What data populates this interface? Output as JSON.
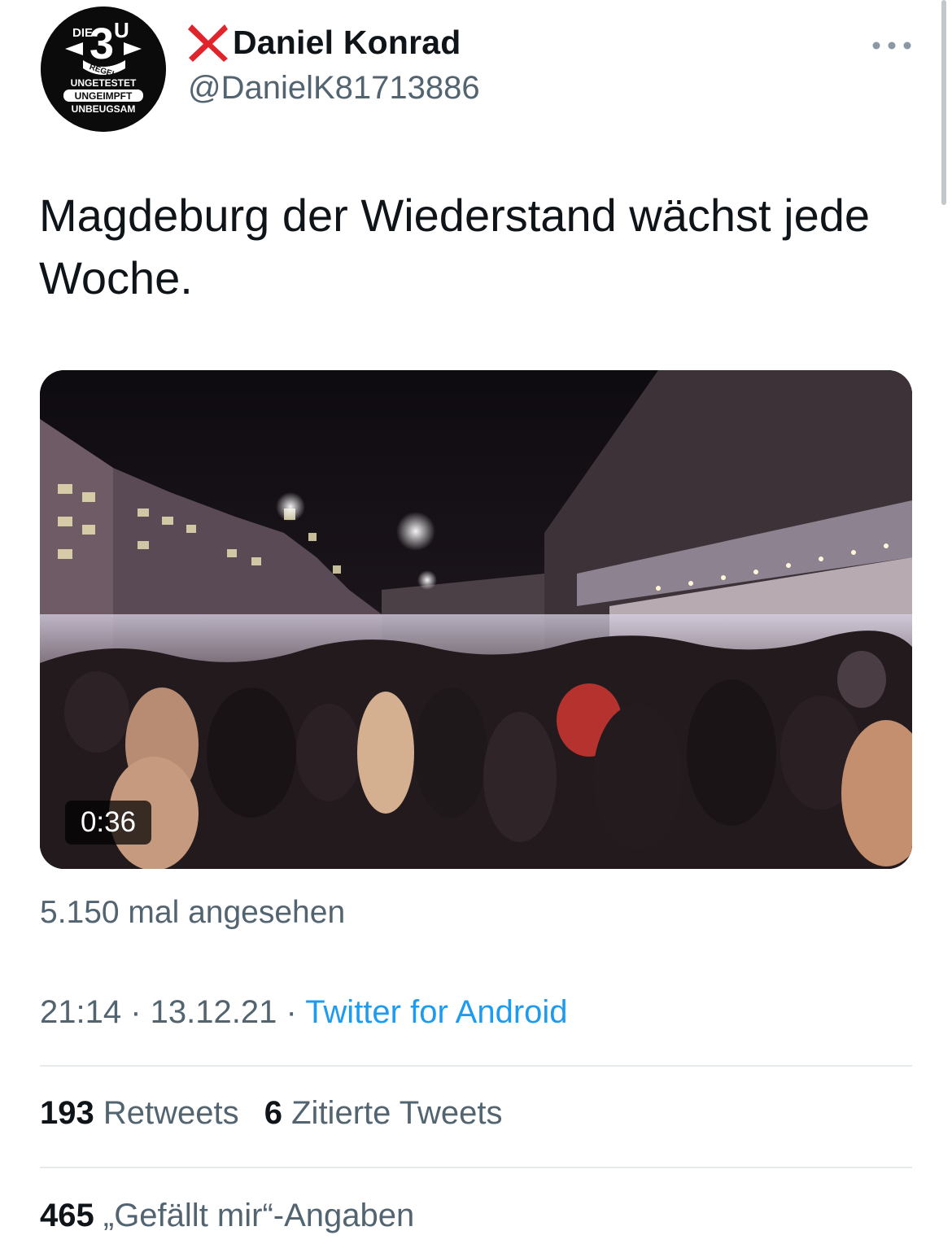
{
  "avatar": {
    "top_text": "DIE",
    "number": "3",
    "letter": "U",
    "ribbon": "REGEL",
    "lines": [
      "UNGETESTET",
      "UNGEIMPFT",
      "UNBEUGSAM"
    ]
  },
  "author": {
    "name_prefix_icon": "red-x-icon",
    "display_name": "Daniel Konrad",
    "handle": "@DanielK81713886"
  },
  "more_icon": "more-horizontal-icon",
  "tweet": {
    "text": "Magdeburg der Wiederstand wächst jede Woche."
  },
  "video": {
    "duration": "0:36"
  },
  "views": "5.150 mal angesehen",
  "meta": {
    "time": "21:14",
    "separator": " · ",
    "date": "13.12.21",
    "source": "Twitter for Android"
  },
  "stats": {
    "retweets_count": "193",
    "retweets_label": "Retweets",
    "quotes_count": "6",
    "quotes_label": "Zitierte Tweets",
    "likes_count": "465",
    "likes_label": "„Gefällt mir“-Angaben"
  },
  "colors": {
    "primary_text": "#0f1419",
    "secondary_text": "#536471",
    "link": "#1d9bf0",
    "x_mark": "#e0242b",
    "divider": "#e7eaed"
  }
}
